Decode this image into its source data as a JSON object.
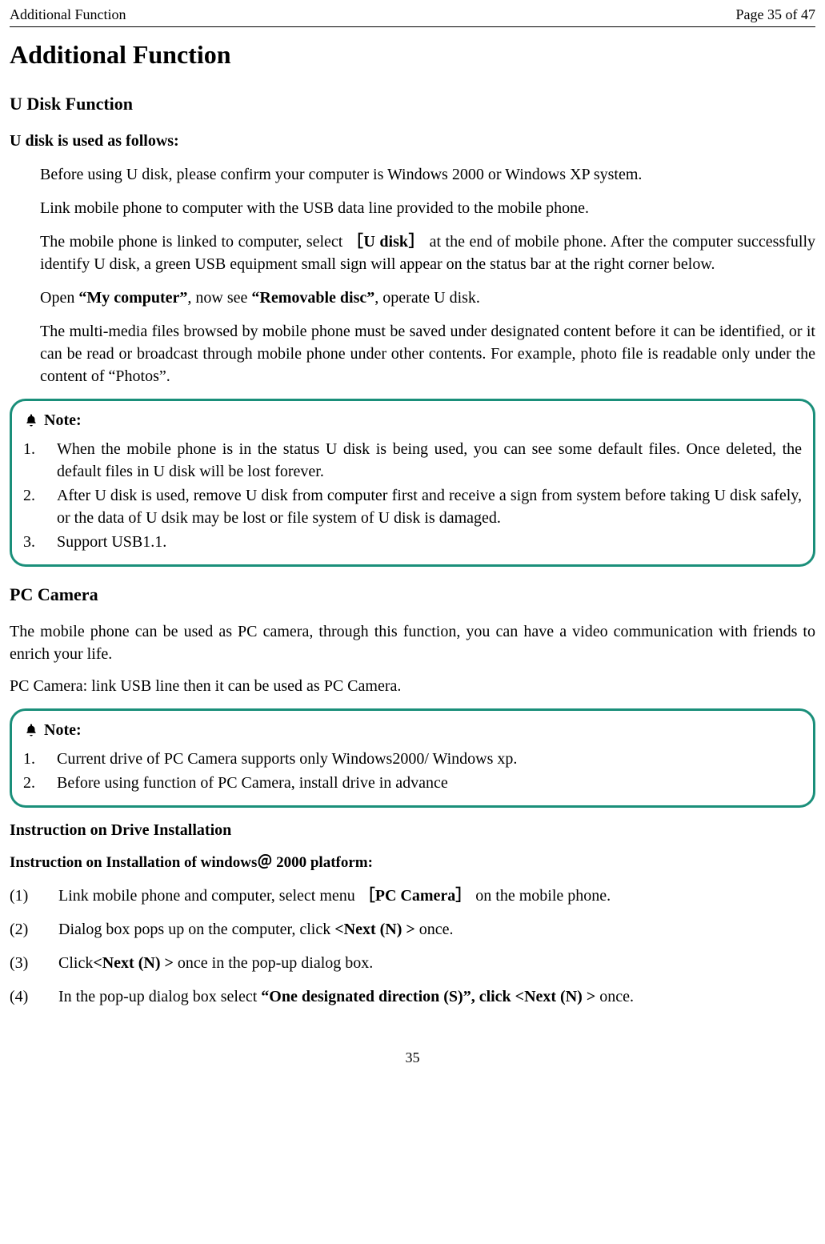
{
  "header": {
    "title_left": "Additional Function",
    "title_right": "Page 35 of 47"
  },
  "h1": "Additional Function",
  "udisk": {
    "heading": "U Disk Function",
    "sub": "U disk is used as follows:",
    "p1": "Before using U disk, please confirm your computer is Windows 2000 or Windows XP system.",
    "p2": "Link mobile phone to computer with the USB data line provided to the mobile phone.",
    "p3a": "The mobile phone is linked to computer, select",
    "p3b": "［U disk］",
    "p3c": "at the end of mobile phone. After the computer successfully identify U disk, a green USB equipment small sign will appear on the status bar at the right corner below.",
    "p4a": "Open ",
    "p4b": "“My computer”",
    "p4c": ", now see ",
    "p4d": "“Removable disc”",
    "p4e": ", operate U disk.",
    "p5": "The multi-media files browsed by mobile phone must be saved under designated content before it can be identified, or it can be read or broadcast through mobile phone under other contents. For example, photo file is readable only under the content of “Photos”."
  },
  "note1": {
    "label": "Note:",
    "items": [
      {
        "n": "1.",
        "t": "   When the mobile phone is in the status U disk is being used, you can see some default files. Once deleted, the default files in U disk will be lost forever."
      },
      {
        "n": "2.",
        "t": "After U disk is used, remove U disk from computer first and receive a sign from system before taking U disk safely, or the data of U dsik may be lost or file system of U disk is damaged."
      },
      {
        "n": "3.",
        "t": "Support USB1.1."
      }
    ]
  },
  "pccam": {
    "heading": "PC Camera",
    "p1": "The mobile phone can be used as PC camera, through this function, you can have a video communication with friends to enrich your life.",
    "p2": "PC Camera: link USB line then it can be used as PC Camera."
  },
  "note2": {
    "label": "Note:",
    "items": [
      {
        "n": "1.",
        "t": "Current drive of PC Camera supports only Windows2000/ Windows xp."
      },
      {
        "n": "2.",
        "t": "Before using function of PC Camera, install drive in advance"
      }
    ]
  },
  "install": {
    "heading": "Instruction on Drive Installation",
    "sub": "Instruction on Installation of windows＠ 2000 platform:",
    "steps": {
      "s1": {
        "n": "(1)",
        "a": "Link mobile phone and computer, select menu",
        "b": "［PC Camera］",
        "c": "on the mobile phone."
      },
      "s2": {
        "n": "(2)",
        "a": "Dialog box pops up on the computer, click ",
        "b": "<Next (N) >",
        "c": " once."
      },
      "s3": {
        "n": "(3)",
        "a": "Click",
        "b": "<Next (N) >",
        "c": " once in the pop-up dialog box."
      },
      "s4": {
        "n": "(4)",
        "a": "In the pop-up dialog box select ",
        "b": "“One designated direction (S)”, click <Next (N) >",
        "c": " once."
      }
    }
  },
  "footer_page": "35"
}
